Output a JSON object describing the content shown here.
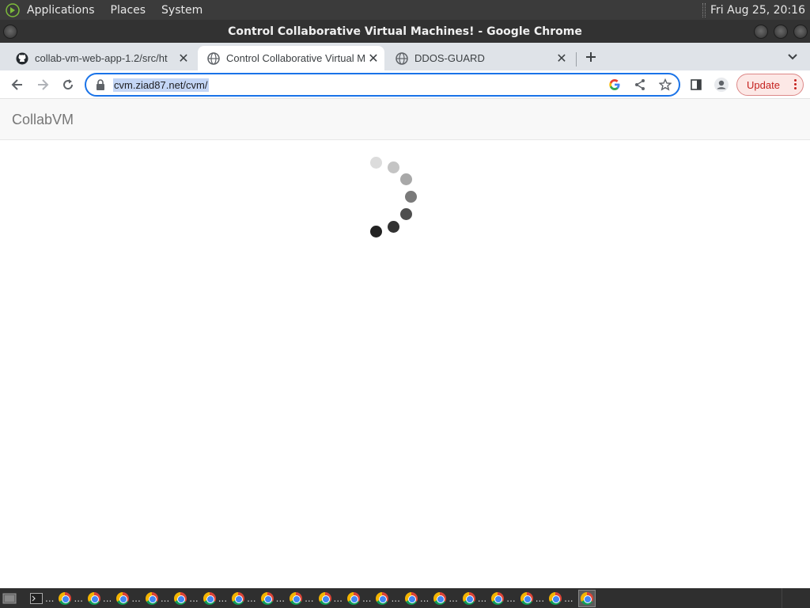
{
  "system_panel": {
    "menus": [
      "Applications",
      "Places",
      "System"
    ],
    "clock": "Fri Aug 25, 20:16"
  },
  "window": {
    "title": "Control Collaborative Virtual Machines! - Google Chrome"
  },
  "tabs": [
    {
      "title": "collab-vm-web-app-1.2/src/ht",
      "icon": "github-icon",
      "active": false
    },
    {
      "title": "Control Collaborative Virtual M",
      "icon": "globe-icon",
      "active": true
    },
    {
      "title": "DDOS-GUARD",
      "icon": "globe-icon",
      "active": false
    }
  ],
  "toolbar": {
    "url": "cvm.ziad87.net/cvm/",
    "update_label": "Update"
  },
  "page": {
    "brand": "CollabVM",
    "spinner_colors": [
      "#f2f2f2",
      "#dcdcdc",
      "#c4c4c4",
      "#a8a8a8",
      "#7a7a7a",
      "#4e4e4e",
      "#333333",
      "#222222"
    ]
  },
  "taskbar": {
    "item_ellipsis": "...",
    "chrome_window_count": 19
  },
  "colors": {
    "accent": "#1a73e8",
    "update_text": "#c5221f",
    "brand_text": "#777777"
  }
}
